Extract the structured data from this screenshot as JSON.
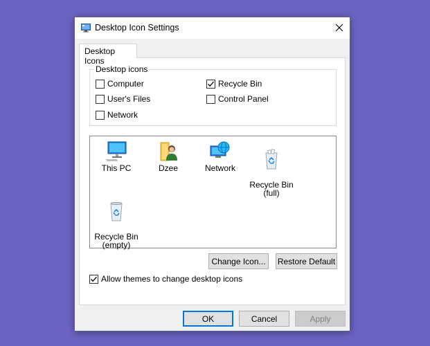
{
  "window": {
    "title": "Desktop Icon Settings",
    "close_glyph": "✕"
  },
  "tabs": [
    {
      "label": "Desktop Icons",
      "selected": true
    }
  ],
  "desktop_icons_group": {
    "legend": "Desktop icons",
    "checkboxes": [
      {
        "label": "Computer",
        "checked": false
      },
      {
        "label": "Recycle Bin",
        "checked": true
      },
      {
        "label": "User's Files",
        "checked": false
      },
      {
        "label": "Control Panel",
        "checked": false
      },
      {
        "label": "Network",
        "checked": false
      }
    ]
  },
  "icon_list": {
    "items": [
      {
        "label": "This PC",
        "icon": "computer-monitor-icon"
      },
      {
        "label": "Dzee",
        "icon": "user-folder-icon"
      },
      {
        "label": "Network",
        "icon": "network-globe-icon"
      },
      {
        "label": "Recycle Bin\n(full)",
        "icon": "recycle-bin-full-icon"
      },
      {
        "label": "Recycle Bin\n(empty)",
        "icon": "recycle-bin-empty-icon"
      }
    ]
  },
  "icon_buttons": {
    "change_icon": "Change Icon...",
    "restore_default": "Restore Default"
  },
  "allow_themes": {
    "label": "Allow themes to change desktop icons",
    "checked": true
  },
  "footer": {
    "ok": "OK",
    "cancel": "Cancel",
    "apply": "Apply",
    "apply_enabled": false
  },
  "colors": {
    "background": "#6b63c2",
    "accent": "#0078d7"
  }
}
